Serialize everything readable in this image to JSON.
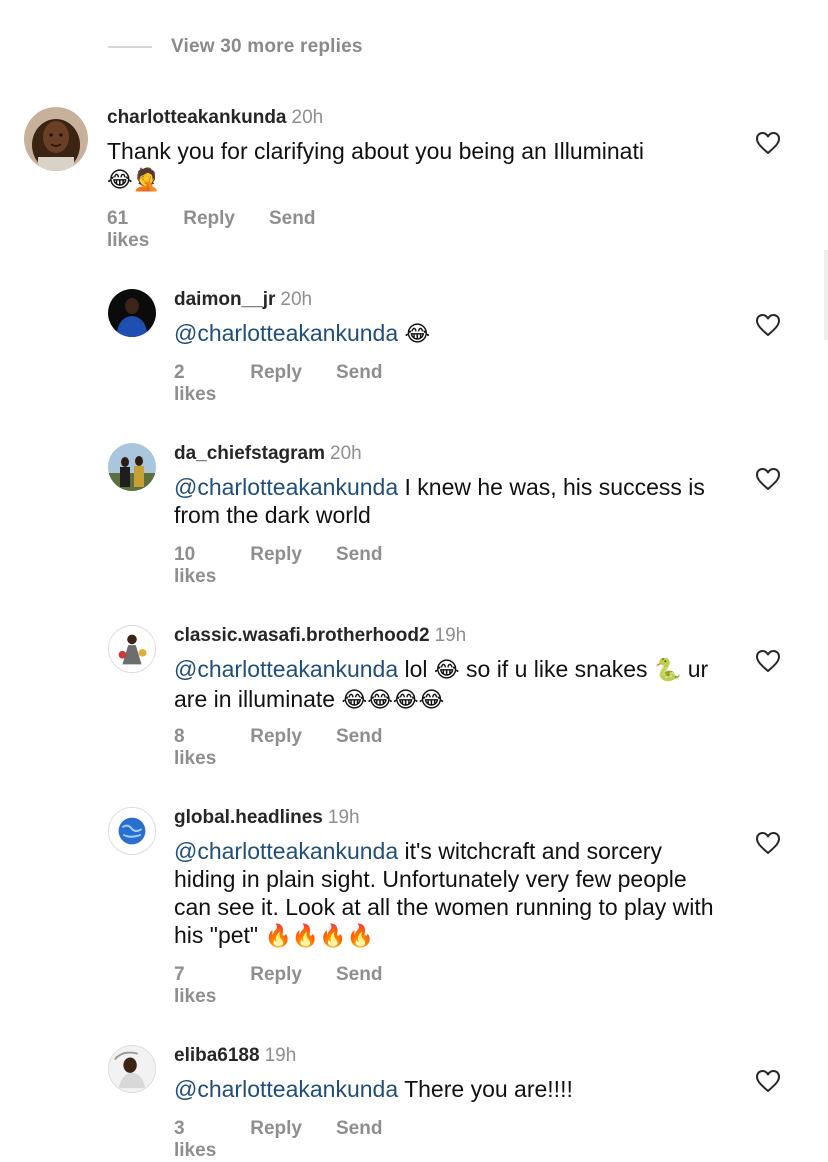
{
  "view_more": {
    "label": "View 30 more replies"
  },
  "comments": [
    {
      "username": "charlotteakankunda",
      "time": "20h",
      "text": "Thank you for clarifying about you being an Illuminati",
      "emojis": "😂🤦",
      "likes": "61 likes",
      "reply": "Reply",
      "send": "Send"
    },
    {
      "username": "daimon__jr",
      "time": "20h",
      "mention": "@charlotteakankunda",
      "text": "",
      "emojis": "😂",
      "likes": "2 likes",
      "reply": "Reply",
      "send": "Send"
    },
    {
      "username": "da_chiefstagram",
      "time": "20h",
      "mention": "@charlotteakankunda",
      "text": "I knew he was, his success is from the dark world",
      "likes": "10 likes",
      "reply": "Reply",
      "send": "Send"
    },
    {
      "username": "classic.wasafi.brotherhood2",
      "time": "19h",
      "mention": "@charlotteakankunda",
      "text_a": "lol",
      "emoji_a": "😂",
      "text_b": "so if u like snakes",
      "emoji_b": "🐍",
      "text_c": "ur are in illuminate",
      "emoji_c": "😂😂😂😂",
      "likes": "8 likes",
      "reply": "Reply",
      "send": "Send"
    },
    {
      "username": "global.headlines",
      "time": "19h",
      "mention": "@charlotteakankunda",
      "text": "it's witchcraft and sorcery hiding in plain sight. Unfortunately very few people can see it. Look at all the women running to play with his \"pet\"",
      "emojis": "🔥🔥🔥🔥",
      "likes": "7 likes",
      "reply": "Reply",
      "send": "Send"
    },
    {
      "username": "eliba6188",
      "time": "19h",
      "mention": "@charlotteakankunda",
      "text": "There you are!!!!",
      "likes": "3 likes",
      "reply": "Reply",
      "send": "Send"
    }
  ],
  "colors": {
    "mention": "#1f4e79",
    "muted": "#8e8e8e",
    "text": "#111111"
  },
  "icons": {
    "like": "heart-outline-icon"
  }
}
